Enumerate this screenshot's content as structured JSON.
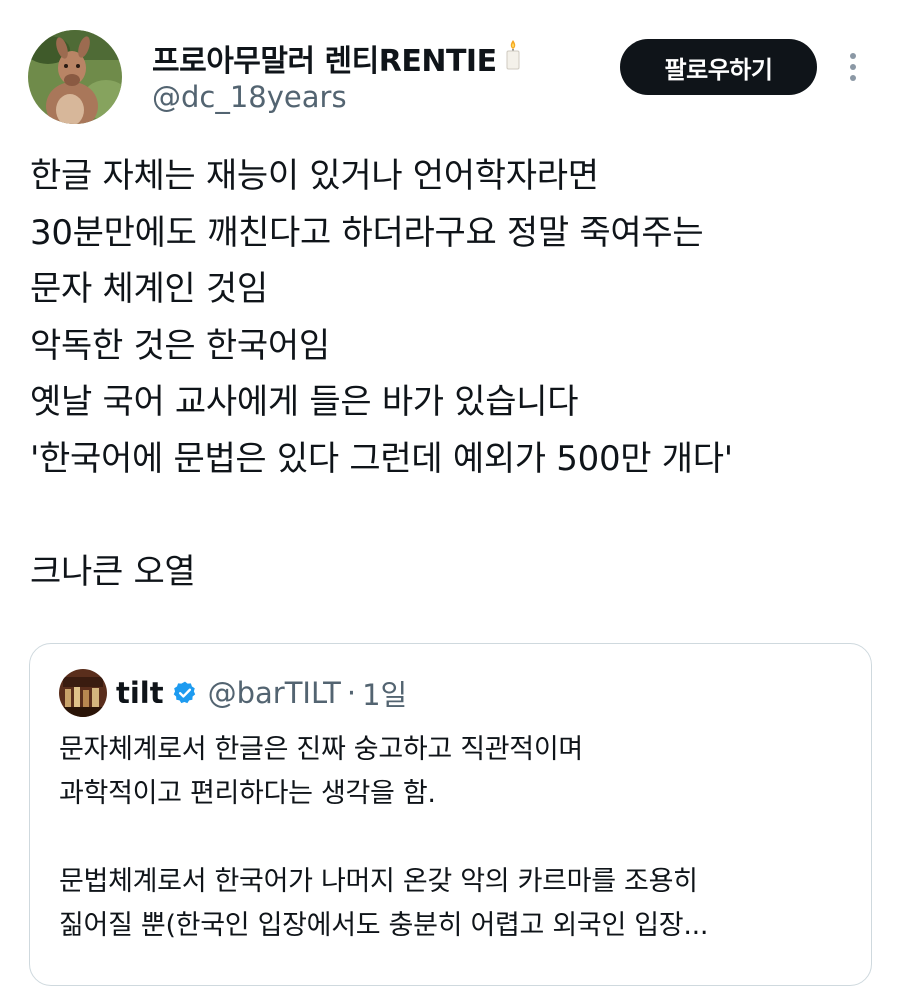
{
  "author": {
    "display_name": "프로아무말러 렌티RENTIE",
    "handle": "@dc_18years",
    "badge_emoji": "candle"
  },
  "actions": {
    "follow_label": "팔로우하기",
    "more_icon": "more-vertical-icon"
  },
  "tweet": {
    "lines": [
      "한글 자체는 재능이 있거나 언어학자라면",
      "30분만에도 깨친다고 하더라구요 정말 죽여주는",
      "문자 체계인 것임",
      "악독한 것은 한국어임",
      "옛날 국어 교사에게 들은 바가 있습니다",
      "'한국어에 문법은 있다 그런데 예외가 500만 개다'",
      "",
      "크나큰 오열"
    ]
  },
  "quote": {
    "name": "tilt",
    "handle": "@barTILT",
    "separator": "·",
    "time": "1일",
    "verified_color": "#1d9bf0",
    "lines": [
      "문자체계로서 한글은 진짜 숭고하고 직관적이며",
      "과학적이고 편리하다는 생각을 함.",
      "",
      "문법체계로서 한국어가 나머지 온갖 악의 카르마를 조용히",
      "짊어질 뿐(한국인 입장에서도 충분히 어렵고 외국인 입장..."
    ]
  }
}
